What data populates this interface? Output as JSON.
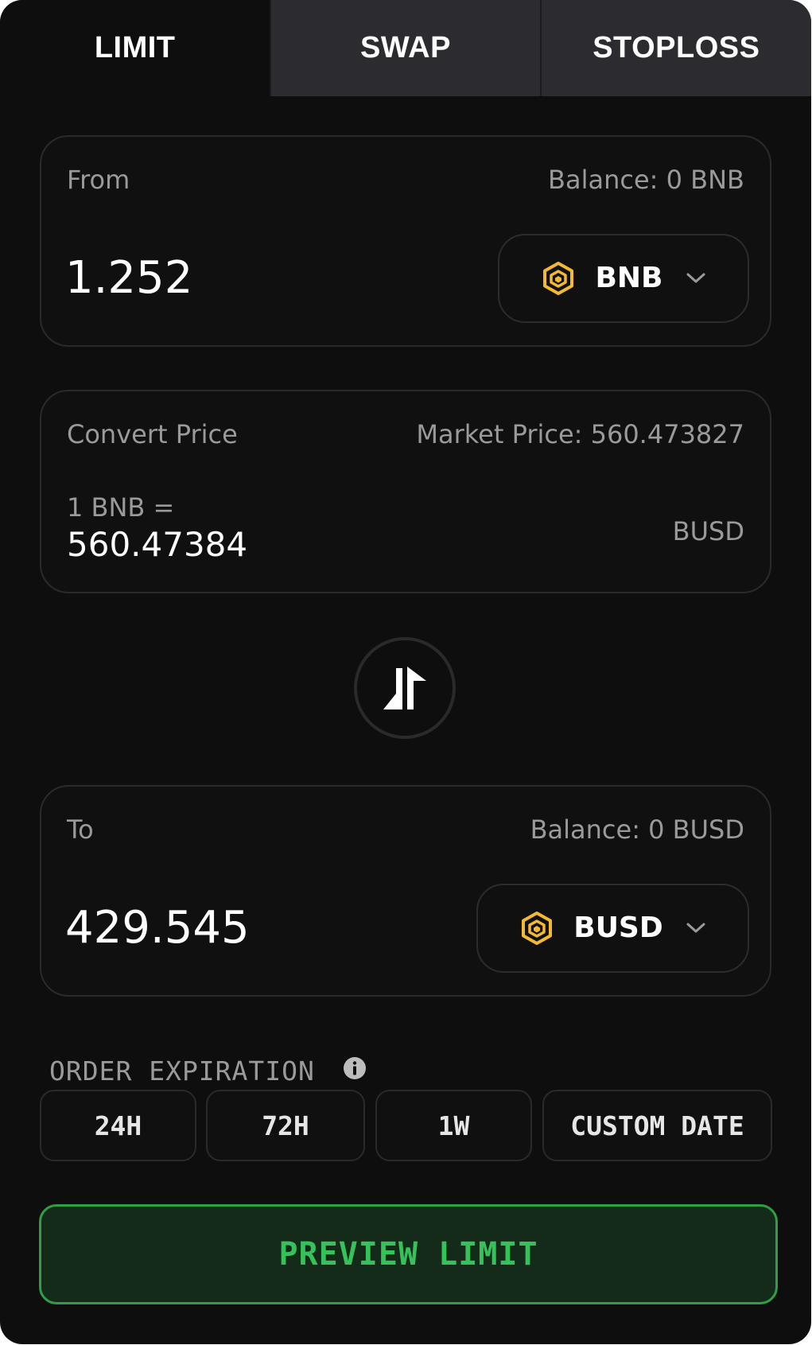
{
  "tabs": [
    {
      "label": "LIMIT",
      "active": true
    },
    {
      "label": "SWAP",
      "active": false
    },
    {
      "label": "STOPLOSS",
      "active": false
    }
  ],
  "from": {
    "label": "From",
    "balance": "Balance: 0 BNB",
    "amount": "1.252",
    "token": "BNB",
    "token_icon": "bnb-logo-icon"
  },
  "price": {
    "label": "Convert Price",
    "market": "Market Price: 560.473827",
    "rate_prefix": "1 BNB =",
    "rate_value": "560.47384",
    "rate_unit": "BUSD"
  },
  "swap_direction_icon": "swap-arrows-icon",
  "to": {
    "label": "To",
    "balance": "Balance: 0 BUSD",
    "amount": "429.545",
    "token": "BUSD",
    "token_icon": "busd-logo-icon"
  },
  "expiration": {
    "label": "ORDER EXPIRATION",
    "info_icon": "info-icon",
    "options": [
      "24H",
      "72H",
      "1W",
      "CUSTOM DATE"
    ]
  },
  "preview_button": "PREVIEW LIMIT",
  "colors": {
    "background": "#0e0e0e",
    "inactive_tab": "#2b2b30",
    "token_yellow": "#f3ba2f",
    "accent_green": "#36c25a",
    "button_green_bg": "#142b1a"
  }
}
